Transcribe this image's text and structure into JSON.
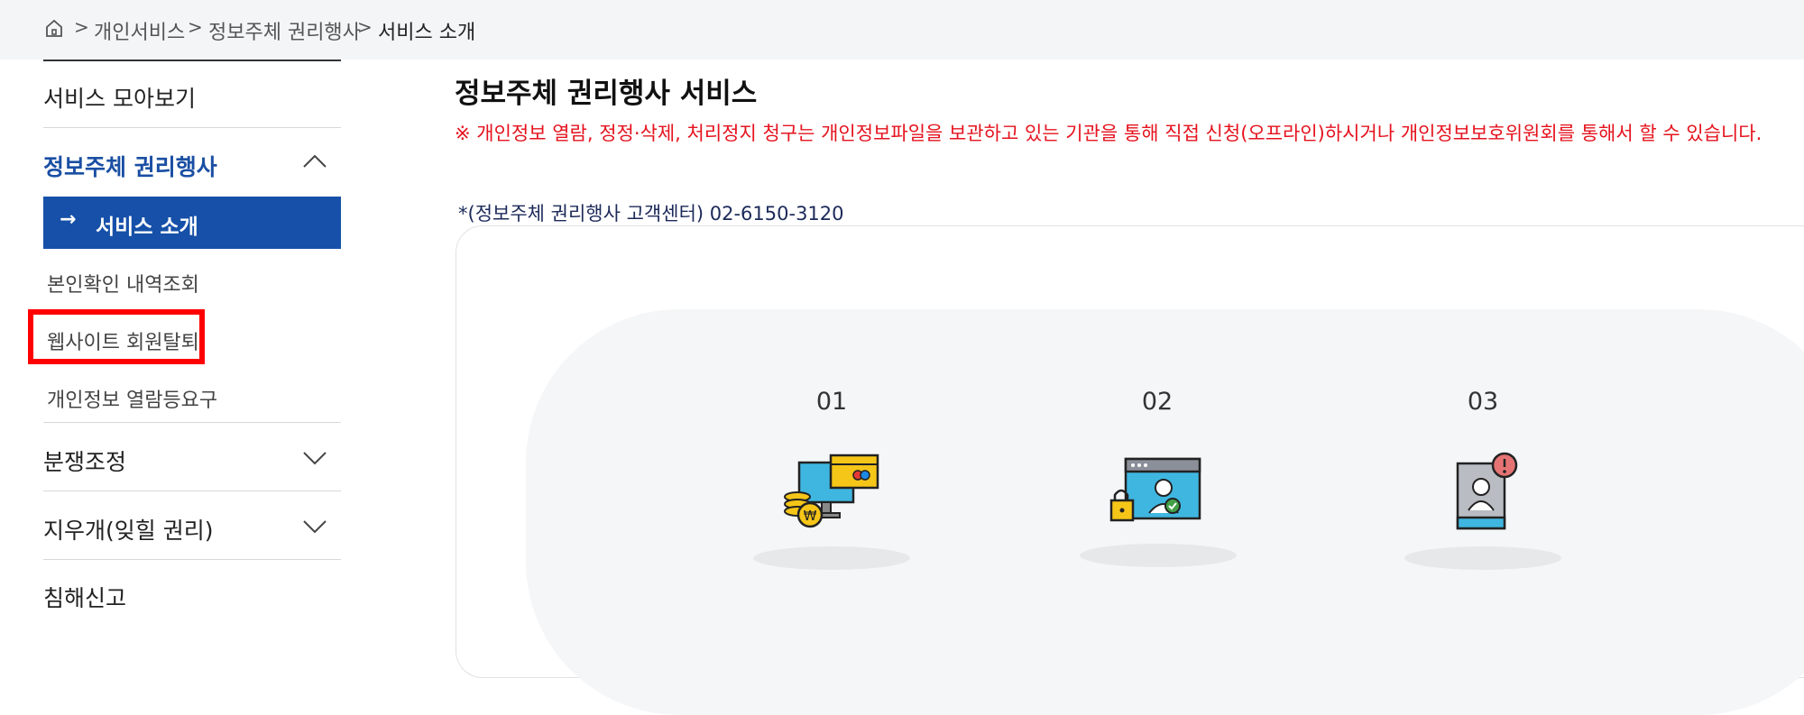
{
  "breadcrumb": {
    "items": [
      "개인서비스",
      "정보주체 권리행사",
      "서비스 소개"
    ],
    "separator": ">"
  },
  "sidebar": {
    "items": [
      {
        "label": "서비스 모아보기"
      },
      {
        "label": "정보주체 권리행사",
        "expanded": true
      },
      {
        "label": "분쟁조정"
      },
      {
        "label": "지우개(잊힐 권리)"
      },
      {
        "label": "침해신고"
      }
    ],
    "active_sub": {
      "arrow": "→",
      "label": "서비스 소개"
    },
    "sub_items": [
      "본인확인 내역조회",
      "웹사이트 회원탈퇴",
      "개인정보 열람등요구"
    ]
  },
  "main": {
    "title": "정보주체 권리행사 서비스",
    "notice": "※ 개인정보 열람, 정정·삭제, 처리정지 청구는 개인정보파일을 보관하고 있는 기관을 통해 직접 신청(오프라인)하시거나 개인정보보호위원회를 통해서 할 수 있습니다.",
    "phone": "*(정보주체 권리행사 고객센터) 02-6150-3120",
    "steps": [
      {
        "num": "01",
        "icon": "computer-money-icon"
      },
      {
        "num": "02",
        "icon": "browser-lock-user-icon"
      },
      {
        "num": "03",
        "icon": "id-card-alert-icon"
      }
    ]
  },
  "colors": {
    "accent": "#1650a8",
    "notice_red": "#e5131e",
    "highlight_box": "#ff0000",
    "topbar_bg": "#f4f5f7"
  }
}
